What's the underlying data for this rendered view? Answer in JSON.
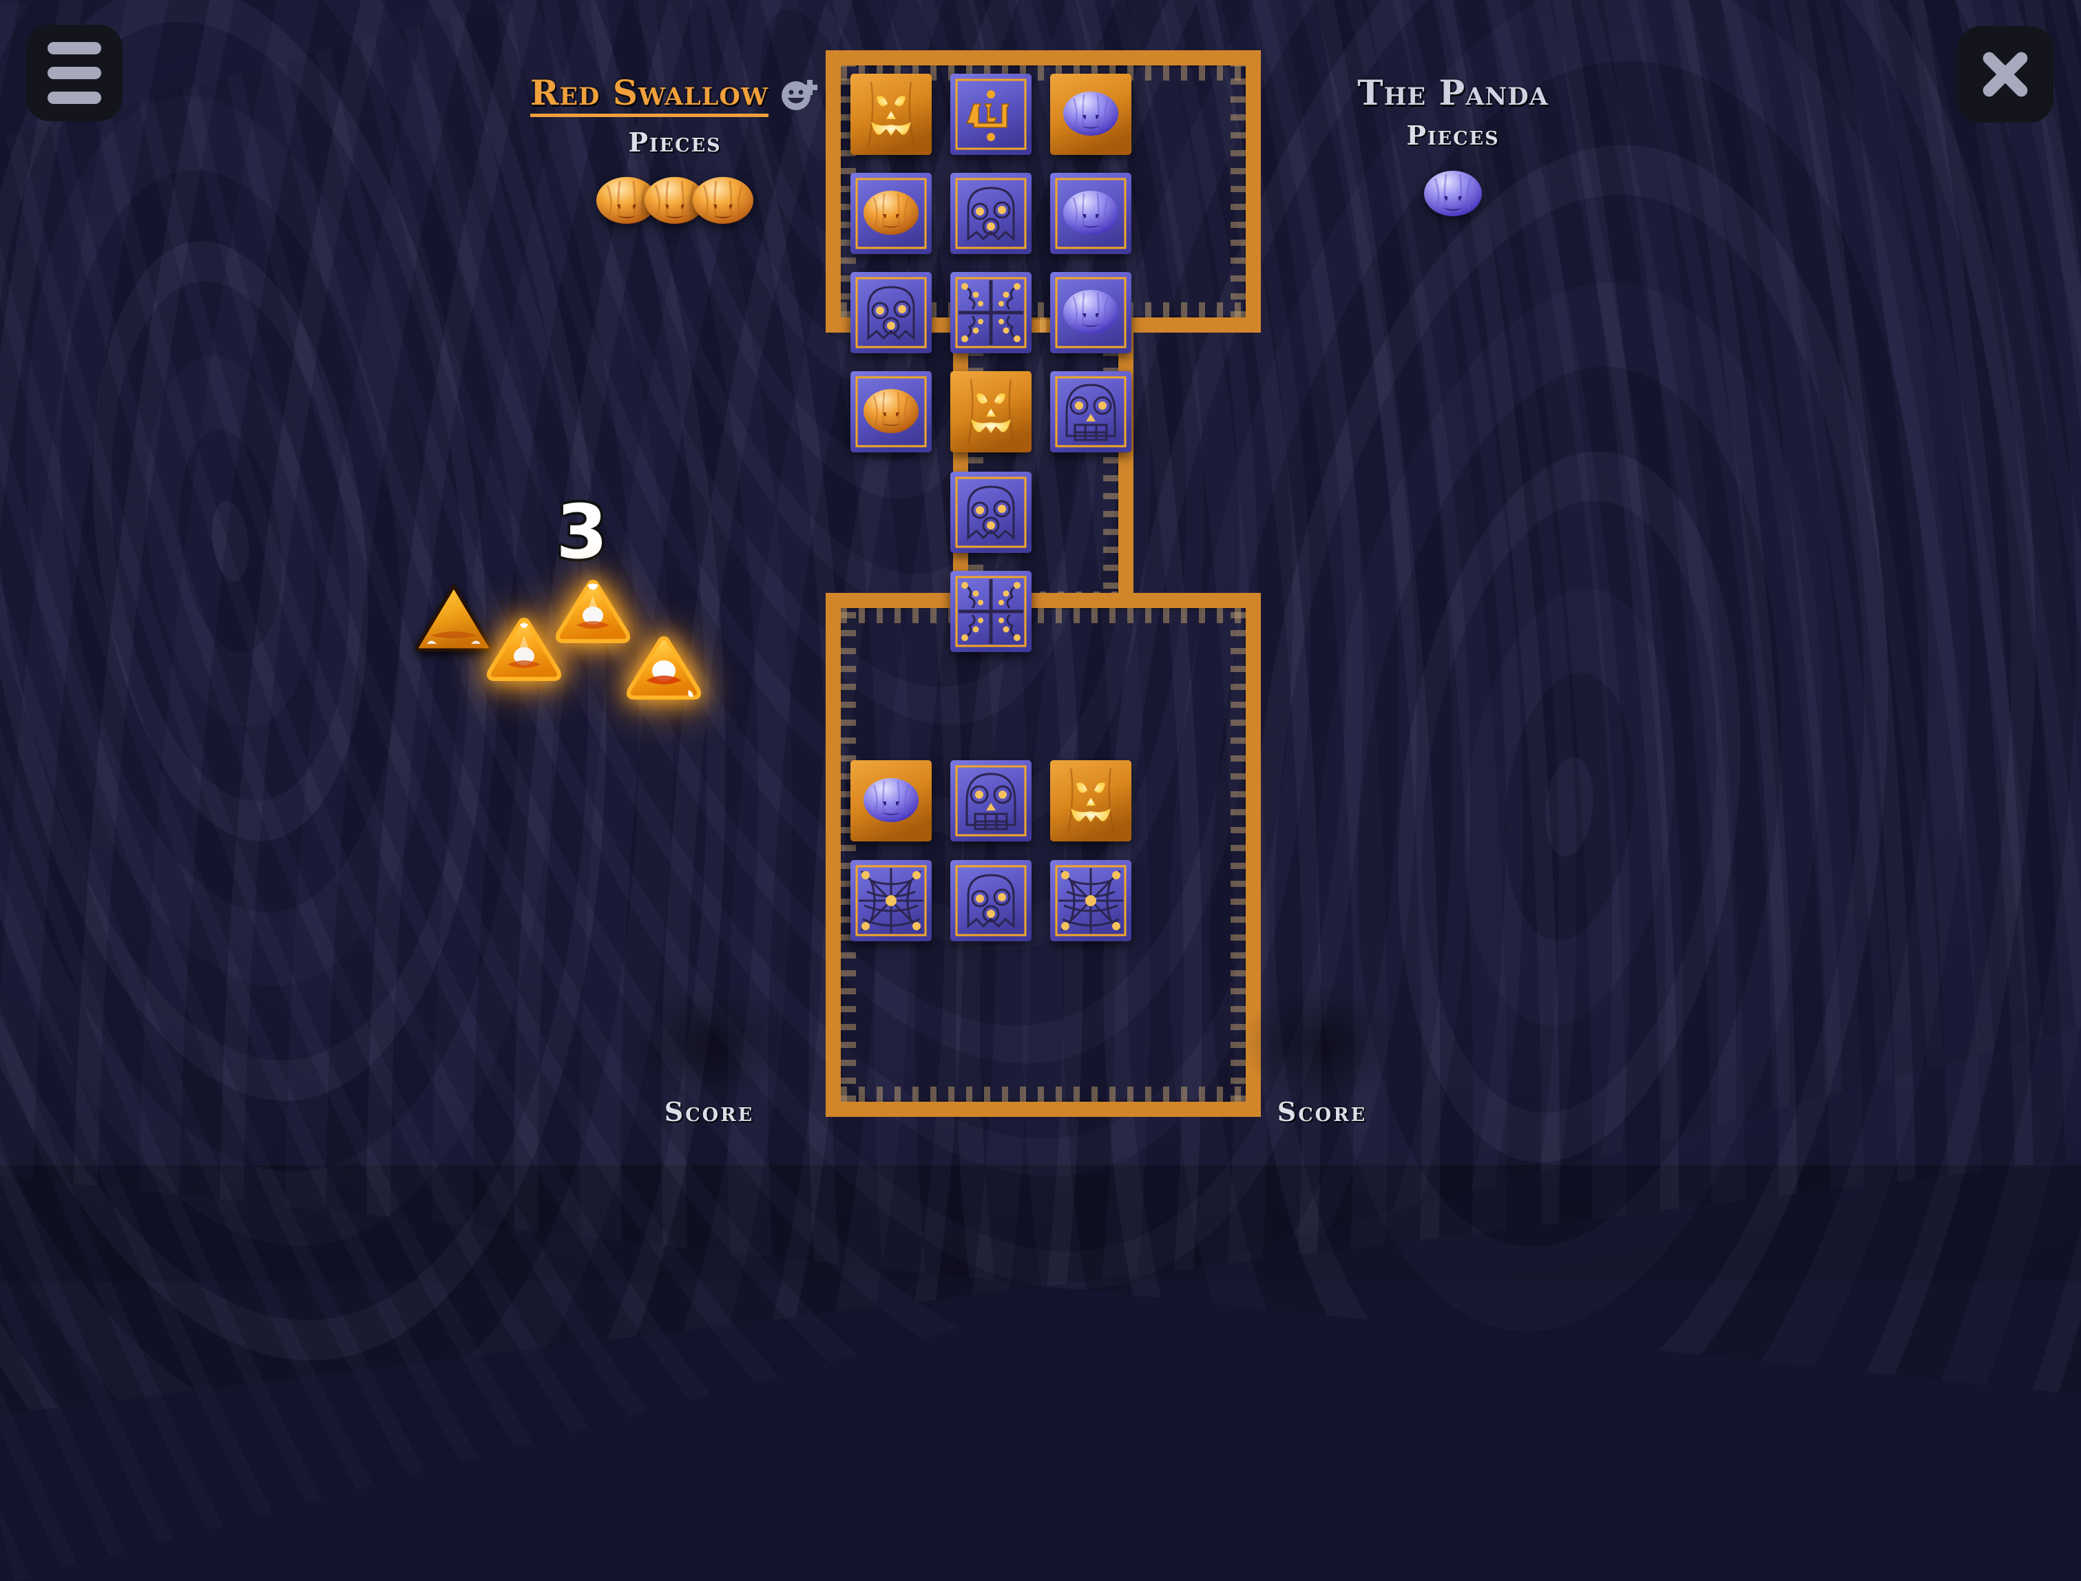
{
  "app": {
    "background_color": "#1b1b3c",
    "accent_orange": "#f0a03c",
    "frame_color": "#d2862a",
    "tile_blue": "#5a5ac8",
    "tile_orange": "#d9881f"
  },
  "topbar": {
    "menu_button_label": "Menu",
    "menu_icon": "hamburger-icon",
    "close_button_label": "Close",
    "close_icon": "close-x-icon"
  },
  "players": [
    {
      "id": "left",
      "name": "Red Swallow",
      "active": true,
      "pieces_label": "Pieces",
      "piece_color": "orange",
      "piece_count": 3,
      "score_label": "Score",
      "friend_icon": "add-friend-icon"
    },
    {
      "id": "right",
      "name": "The Panda",
      "active": false,
      "pieces_label": "Pieces",
      "piece_color": "blue",
      "piece_count": 1,
      "score_label": "Score",
      "friend_icon": null
    }
  ],
  "roll": {
    "value": "3",
    "dice_total": 4,
    "dice": [
      {
        "index": 0,
        "lit": false,
        "shape": "candy-corn-triangle"
      },
      {
        "index": 1,
        "lit": true,
        "shape": "candy-corn-triangle"
      },
      {
        "index": 2,
        "lit": true,
        "shape": "candy-corn-triangle"
      },
      {
        "index": 3,
        "lit": true,
        "shape": "candy-corn-triangle"
      }
    ]
  },
  "board": {
    "shape": "i-beam",
    "regions": [
      "top-wide",
      "middle-corridor",
      "bottom-wide"
    ],
    "columns": 3,
    "tiles": [
      {
        "row": 0,
        "col": 0,
        "bg": "orange",
        "art": "jack-o-lantern-face",
        "piece": null
      },
      {
        "row": 0,
        "col": 1,
        "bg": "blue",
        "art": "rune-glyph",
        "piece": null
      },
      {
        "row": 0,
        "col": 2,
        "bg": "orange",
        "art": "plain-wood",
        "piece": "blue-pumpkin"
      },
      {
        "row": 1,
        "col": 0,
        "bg": "blue",
        "art": "ghost-three-dots",
        "piece": "orange-pumpkin"
      },
      {
        "row": 1,
        "col": 1,
        "bg": "blue",
        "art": "ghost-three-dots",
        "piece": null
      },
      {
        "row": 1,
        "col": 2,
        "bg": "blue",
        "art": "plain-slab",
        "piece": "blue-pumpkin"
      },
      {
        "row": 2,
        "col": 0,
        "bg": "blue",
        "art": "ghost-three-dots",
        "piece": null
      },
      {
        "row": 2,
        "col": 1,
        "bg": "blue",
        "art": "window-four-pane",
        "piece": null
      },
      {
        "row": 2,
        "col": 2,
        "bg": "blue",
        "art": "plain-slab",
        "piece": "blue-pumpkin"
      },
      {
        "row": 3,
        "col": 0,
        "bg": "blue",
        "art": "plain-slab",
        "piece": "orange-pumpkin"
      },
      {
        "row": 3,
        "col": 1,
        "bg": "orange",
        "art": "jack-o-lantern-face",
        "piece": null
      },
      {
        "row": 3,
        "col": 2,
        "bg": "blue",
        "art": "skull",
        "piece": null
      },
      {
        "row": 4,
        "col": 1,
        "bg": "blue",
        "art": "ghost-three-dots",
        "piece": null
      },
      {
        "row": 5,
        "col": 1,
        "bg": "blue",
        "art": "window-four-pane",
        "piece": null
      },
      {
        "row": 6,
        "col": 0,
        "bg": "orange",
        "art": "plain-wood",
        "piece": "blue-pumpkin"
      },
      {
        "row": 6,
        "col": 1,
        "bg": "blue",
        "art": "skull",
        "piece": null
      },
      {
        "row": 6,
        "col": 2,
        "bg": "orange",
        "art": "jack-o-lantern-face",
        "piece": null
      },
      {
        "row": 7,
        "col": 0,
        "bg": "blue",
        "art": "spider-web",
        "piece": null
      },
      {
        "row": 7,
        "col": 1,
        "bg": "blue",
        "art": "ghost-three-dots",
        "piece": null
      },
      {
        "row": 7,
        "col": 2,
        "bg": "blue",
        "art": "spider-web",
        "piece": null
      }
    ]
  }
}
